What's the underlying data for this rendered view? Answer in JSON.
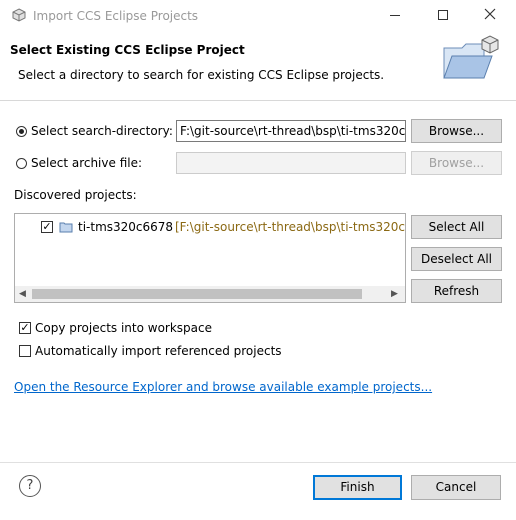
{
  "window": {
    "title": "Import CCS Eclipse Projects"
  },
  "header": {
    "title": "Select Existing CCS Eclipse Project",
    "subtitle": "Select a directory to search for existing CCS Eclipse projects."
  },
  "search_directory": {
    "label": "Select search-directory:",
    "value": "F:\\git-source\\rt-thread\\bsp\\ti-tms320c",
    "browse_label": "Browse..."
  },
  "archive_file": {
    "label": "Select archive file:",
    "value": "",
    "browse_label": "Browse..."
  },
  "projects": {
    "label": "Discovered projects:",
    "items": [
      {
        "name": "ti-tms320c6678",
        "path": "[F:\\git-source\\rt-thread\\bsp\\ti-tms320c",
        "checked": true
      }
    ],
    "select_all_label": "Select All",
    "deselect_all_label": "Deselect All",
    "refresh_label": "Refresh"
  },
  "options": {
    "copy_label": "Copy projects into workspace",
    "copy_checked": true,
    "auto_import_label": "Automatically import referenced projects",
    "auto_import_checked": false
  },
  "link": {
    "text": "Open the Resource Explorer and browse available example projects..."
  },
  "footer": {
    "help_icon": "question-mark",
    "finish_label": "Finish",
    "cancel_label": "Cancel"
  },
  "colors": {
    "accent": "#0078d7",
    "link": "#0066cc",
    "path": "#8b6914"
  }
}
